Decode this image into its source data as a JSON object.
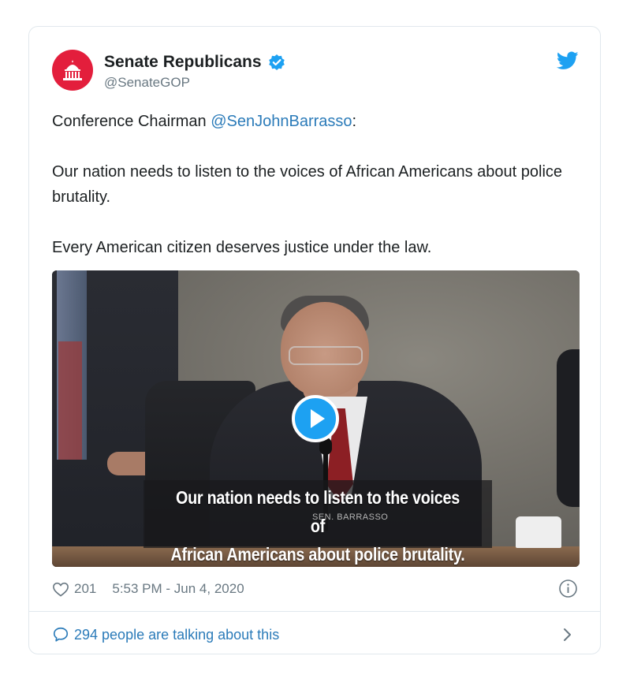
{
  "account": {
    "display_name": "Senate Republicans",
    "handle": "@SenateGOP",
    "verified": true,
    "avatar_color": "#e31e3c"
  },
  "tweet": {
    "line1_prefix": "Conference Chairman ",
    "line1_mention": "@SenJohnBarrasso",
    "line1_suffix": ":",
    "paragraph2": "Our nation needs to listen to the voices of African Americans about police brutality.",
    "paragraph3": "Every American citizen deserves justice under the law."
  },
  "video": {
    "caption_line1": "Our nation needs to listen to the voices of",
    "caption_line2": "African Americans about police brutality.",
    "nameplate": "SEN. BARRASSO"
  },
  "meta": {
    "likes": "201",
    "timestamp": "5:53 PM - Jun 4, 2020"
  },
  "footer": {
    "conversation": "294 people are talking about this"
  },
  "colors": {
    "link": "#2b7bb9",
    "muted": "#697882",
    "twitter_blue": "#1da1f2"
  },
  "icons": [
    "capitol-icon",
    "verified-badge-icon",
    "twitter-bird-icon",
    "play-icon",
    "heart-icon",
    "info-icon",
    "speech-bubble-icon",
    "chevron-right-icon"
  ]
}
